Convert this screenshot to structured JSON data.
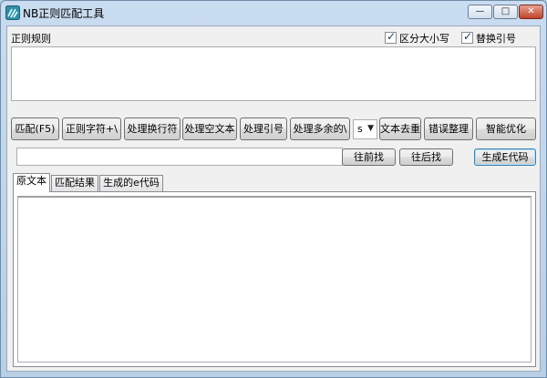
{
  "window": {
    "title": "NB正则匹配工具",
    "controls": {
      "minimize": "—",
      "maximize": "□",
      "close": "✕"
    }
  },
  "regex": {
    "label": "正则规则",
    "value": "",
    "case_sensitive": {
      "label": "区分大小写",
      "checked": true
    },
    "replace_quotes": {
      "label": "替换引号",
      "checked": true
    }
  },
  "toolbar": {
    "match": "匹配(F5)",
    "regex_string": "正则字符+\\",
    "handle_newline": "处理换行符",
    "handle_empty_text": "处理空文本",
    "handle_quotes": "处理引号",
    "handle_extra": "处理多余的\\",
    "select_value": "s",
    "dedupe_text": "文本去重",
    "format_errors": "错误整理",
    "smart_optimize": "智能优化"
  },
  "search": {
    "value": "",
    "find_prev": "往前找",
    "find_next": "往后找",
    "generate_code": "生成E代码"
  },
  "tabs": [
    {
      "label": "原文本",
      "active": true
    },
    {
      "label": "匹配结果",
      "active": false
    },
    {
      "label": "生成的e代码",
      "active": false
    }
  ],
  "source_text": ""
}
